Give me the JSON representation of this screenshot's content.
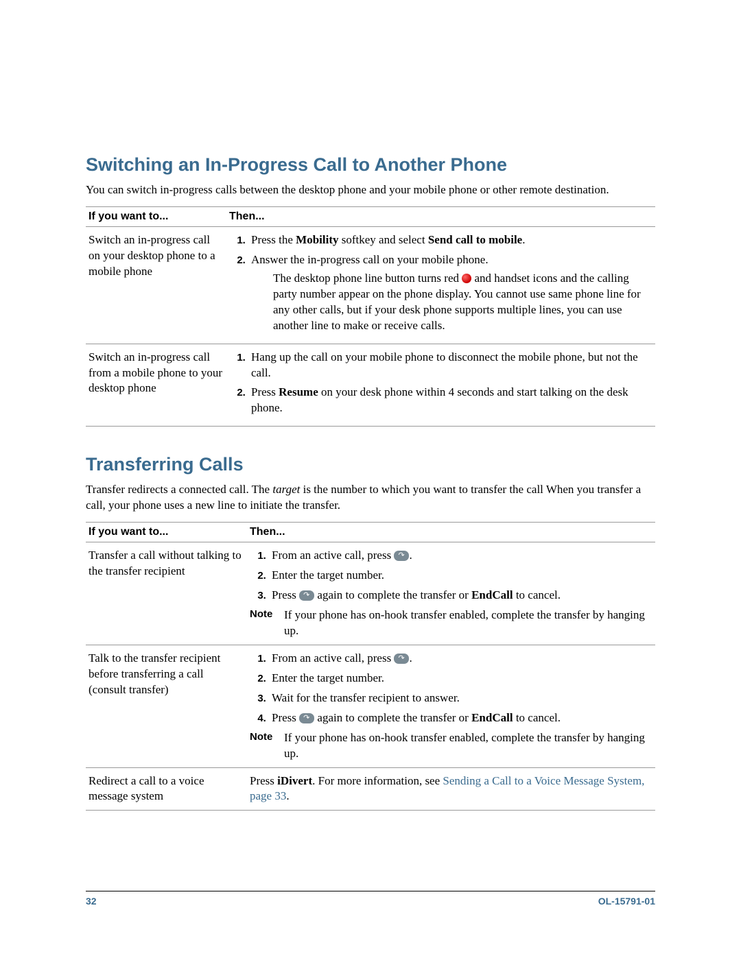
{
  "section1": {
    "heading": "Switching an In-Progress Call to Another Phone",
    "intro": "You can switch in-progress calls between the desktop phone and your mobile phone or other remote destination.",
    "header_col1": "If you want to...",
    "header_col2": "Then...",
    "row1": {
      "goal": "Switch an in-progress call on your desktop phone to a mobile phone",
      "step1_a": "Press the ",
      "step1_b": "Mobility",
      "step1_c": " softkey and select ",
      "step1_d": "Send call to mobile",
      "step1_e": ".",
      "step2": "Answer the in-progress call on your mobile phone.",
      "detail_a": "The desktop phone line button turns red ",
      "detail_b": " and handset icons and the calling party number appear on the phone display. You cannot use same phone line for any other calls, but if your desk phone supports multiple lines, you can use another line to make or receive calls."
    },
    "row2": {
      "goal": "Switch an in-progress call from a mobile phone to your desktop phone",
      "step1": "Hang up the call on your mobile phone to disconnect the mobile phone, but not the call.",
      "step2_a": "Press ",
      "step2_b": "Resume",
      "step2_c": " on your desk phone within 4 seconds and start talking on the desk phone."
    }
  },
  "section2": {
    "heading": "Transferring Calls",
    "intro_a": "Transfer redirects a connected call. The ",
    "intro_b": "target",
    "intro_c": " is the number to which you want to transfer the call When you transfer a call, your phone uses a new line to initiate the transfer.",
    "header_col1": "If you want to...",
    "header_col2": "Then...",
    "row1": {
      "goal": "Transfer a call without talking to the transfer recipient",
      "step1": "From an active call, press ",
      "step1_end": ".",
      "step2": "Enter the target number.",
      "step3_a": "Press ",
      "step3_b": " again to complete the transfer or ",
      "step3_c": "EndCall",
      "step3_d": " to cancel.",
      "note_label": "Note",
      "note_body": "If your phone has on-hook transfer enabled, complete the transfer by hanging up."
    },
    "row2": {
      "goal": "Talk to the transfer recipient before transferring a call (consult transfer)",
      "step1": "From an active call, press ",
      "step1_end": ".",
      "step2": "Enter the target number.",
      "step3": "Wait for the transfer recipient to answer.",
      "step4_a": "Press ",
      "step4_b": " again to complete the transfer or ",
      "step4_c": "EndCall",
      "step4_d": " to cancel.",
      "note_label": "Note",
      "note_body": "If your phone has on-hook transfer enabled, complete the transfer by hanging up."
    },
    "row3": {
      "goal": "Redirect a call to a voice message system",
      "body_a": "Press ",
      "body_b": "iDivert",
      "body_c": ". For more information, see ",
      "link": "Sending a Call to a Voice Message System, page 33",
      "body_d": "."
    }
  },
  "footer": {
    "page": "32",
    "docnum": "OL-15791-01"
  }
}
